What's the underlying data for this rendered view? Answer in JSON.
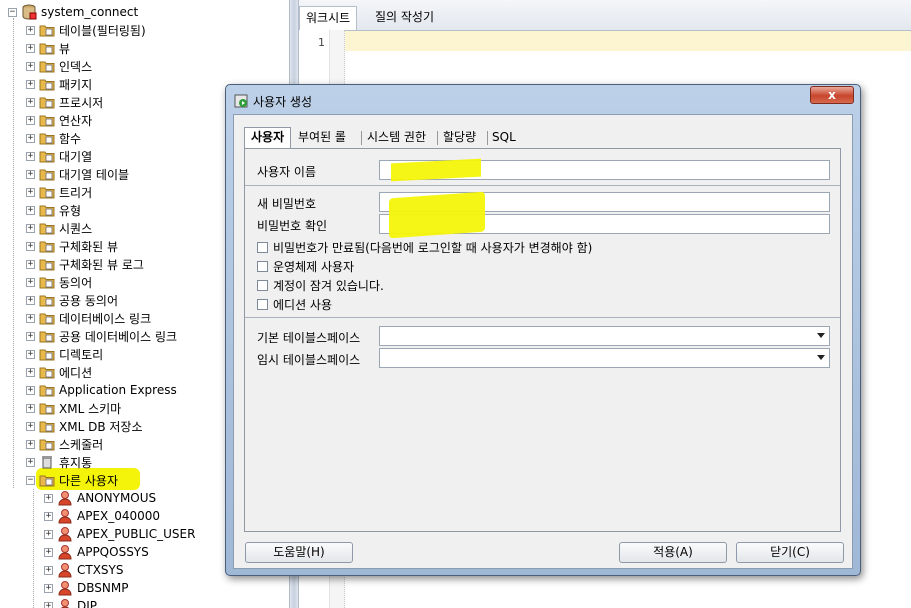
{
  "tree": {
    "root": "system_connect",
    "folders": [
      "테이블(필터링됨)",
      "뷰",
      "인덱스",
      "패키지",
      "프로시저",
      "연산자",
      "함수",
      "대기열",
      "대기열 테이블",
      "트리거",
      "유형",
      "시퀀스",
      "구체화된 뷰",
      "구체화된 뷰 로그",
      "동의어",
      "공용 동의어",
      "데이터베이스 링크",
      "공용 데이터베이스 링크",
      "디렉토리",
      "에디션",
      "Application Express",
      "XML 스키마",
      "XML DB 저장소",
      "스케줄러",
      "휴지통",
      "다른 사용자"
    ],
    "users": [
      "ANONYMOUS",
      "APEX_040000",
      "APEX_PUBLIC_USER",
      "APPQOSSYS",
      "CTXSYS",
      "DBSNMP",
      "DIP"
    ]
  },
  "editor": {
    "tabs": [
      "워크시트",
      "질의 작성기"
    ],
    "line_number": "1"
  },
  "dialog": {
    "title": "사용자 생성",
    "close_label": "x",
    "tabs": [
      "사용자",
      "부여된 롤",
      "시스템 권한",
      "할당량",
      "SQL"
    ],
    "fields": {
      "username_label": "사용자 이름",
      "new_password_label": "새 비밀번호",
      "confirm_password_label": "비밀번호 확인",
      "default_tablespace_label": "기본 테이블스페이스",
      "temp_tablespace_label": "임시 테이블스페이스"
    },
    "checkboxes": [
      "비밀번호가 만료됨(다음번에 로그인할 때 사용자가 변경해야 함)",
      "운영체제 사용자",
      "계정이 잠겨 있습니다.",
      "에디션 사용"
    ],
    "buttons": {
      "help": "도움말(H)",
      "apply": "적용(A)",
      "close": "닫기(C)"
    }
  },
  "colors": {
    "highlight": "#f4f40a",
    "dialog_frame": "#9fb8d6",
    "current_line": "#fdf4d2"
  }
}
